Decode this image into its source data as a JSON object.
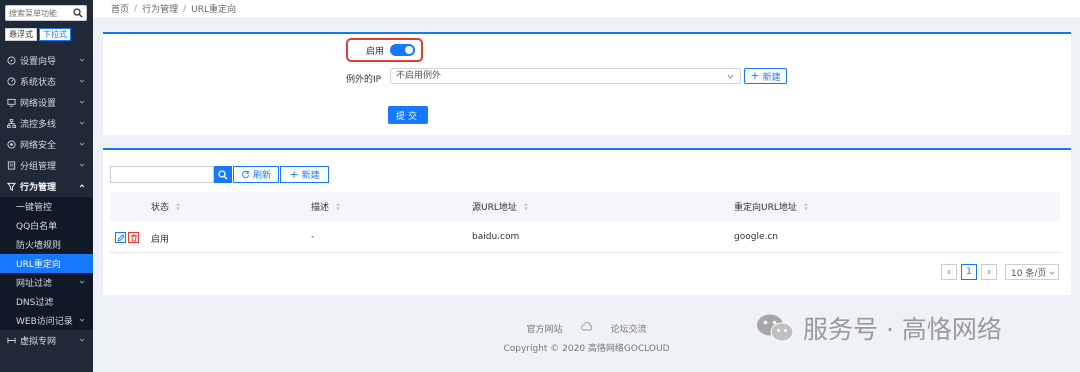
{
  "sidebar": {
    "search_placeholder": "搜索菜单功能",
    "modes": [
      "悬浮式",
      "下拉式"
    ],
    "items": [
      {
        "label": "设置向导"
      },
      {
        "label": "系统状态"
      },
      {
        "label": "网络设置"
      },
      {
        "label": "流控多线"
      },
      {
        "label": "网络安全"
      },
      {
        "label": "分组管理"
      },
      {
        "label": "行为管理"
      }
    ],
    "subitems": [
      {
        "label": "一键管控"
      },
      {
        "label": "QQ白名单"
      },
      {
        "label": "防火墙规则"
      },
      {
        "label": "URL重定向"
      },
      {
        "label": "网址过滤"
      },
      {
        "label": "DNS过滤"
      },
      {
        "label": "WEB访问记录"
      }
    ],
    "after": [
      {
        "label": "虚拟专网"
      }
    ]
  },
  "breadcrumb": [
    "首页",
    "行为管理",
    "URL重定向"
  ],
  "form": {
    "enable_label": "启用",
    "enable_on": true,
    "ip_label": "例外的IP",
    "ip_value": "不启用例外",
    "new_label": "新建",
    "submit_label": "提交"
  },
  "toolbar": {
    "refresh_label": "刷新",
    "new_label": "新建"
  },
  "table": {
    "columns": [
      "状态",
      "描述",
      "源URL地址",
      "重定向URL地址"
    ],
    "rows": [
      {
        "status": "启用",
        "desc": "-",
        "source": "baidu.com",
        "target": "google.cn"
      }
    ]
  },
  "pagination": {
    "page": "1",
    "page_size": "10 条/页"
  },
  "footer": {
    "links": [
      "官方网站",
      "论坛交流"
    ],
    "copyright": "Copyright © 2020 高恪网络GOCLOUD"
  },
  "watermark": {
    "text": "服务号 · 高恪网络"
  },
  "colors": {
    "accent": "#1677ff",
    "sidebar_bg": "#1f2937",
    "highlight": "#e53935"
  }
}
